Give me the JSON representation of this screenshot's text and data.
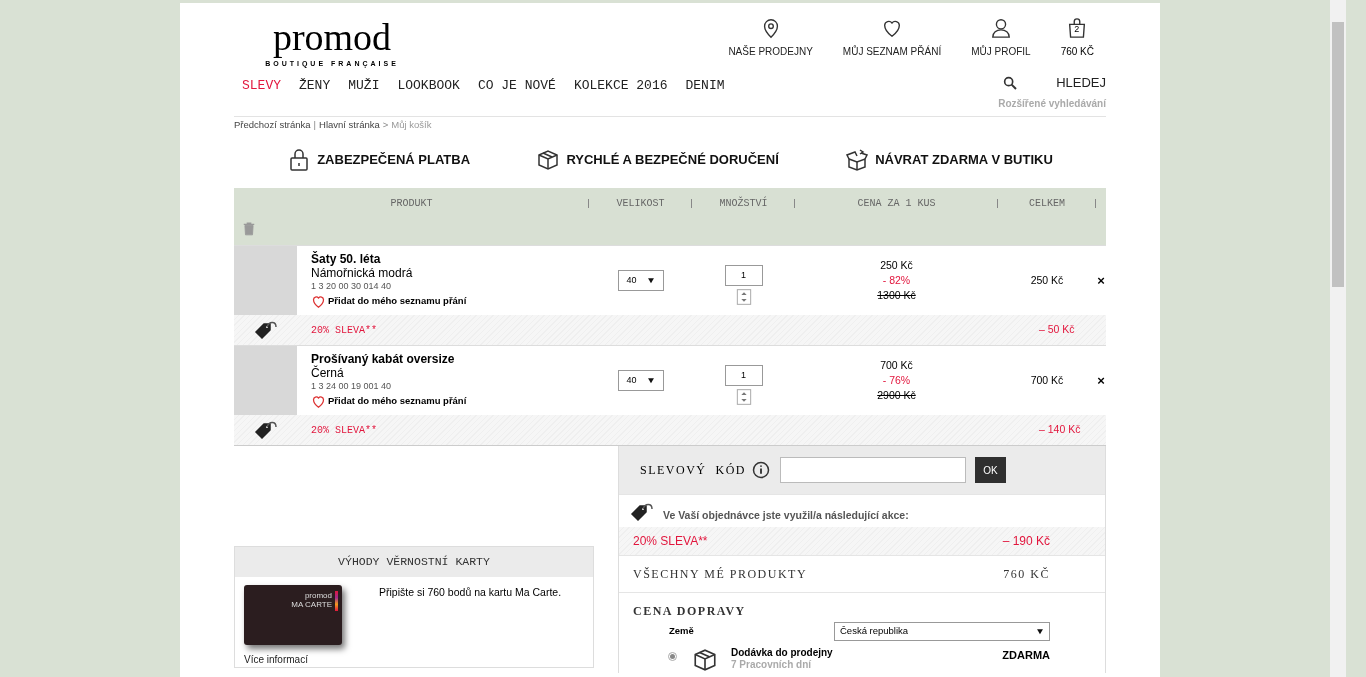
{
  "header": {
    "logo": "promod",
    "tagline": "BOUTIQUE FRANÇAISE",
    "top_links": [
      {
        "kind": "pin",
        "label": "NAŠE PRODEJNY"
      },
      {
        "kind": "heart",
        "label": "MŮJ SEZNAM PŘÁNÍ"
      },
      {
        "kind": "person",
        "label": "MŮJ PROFIL"
      }
    ],
    "cart": {
      "count": "2",
      "total": "760 KČ"
    }
  },
  "nav": [
    {
      "label": "SLEVY",
      "selected": true
    },
    {
      "label": "ŽENY",
      "selected": false
    },
    {
      "label": "MUŽI",
      "selected": false
    },
    {
      "label": "LOOKBOOK",
      "selected": false
    },
    {
      "label": "CO JE NOVÉ",
      "selected": false
    },
    {
      "label": "KOLEKCE 2016",
      "selected": false
    },
    {
      "label": "DENIM",
      "selected": false
    }
  ],
  "search": {
    "label": "HLEDEJ",
    "advanced": "Rozšířené vyhledávání"
  },
  "breadcrumb": [
    {
      "label": "Předchozí stránka",
      "current": false
    },
    {
      "separator": "|",
      "label": "Hlavní stránka",
      "current": false
    },
    {
      "separator": ">",
      "label": "Můj košík",
      "current": true
    }
  ],
  "benefits": [
    {
      "kind": "lock",
      "label": "ZABEZPEČENÁ PLATBA"
    },
    {
      "kind": "box",
      "label": "RYCHLÉ A BEZPEČNÉ DORUČENÍ"
    },
    {
      "kind": "return",
      "label": "NÁVRAT ZDARMA V BUTIKU"
    }
  ],
  "table": {
    "columns": [
      "PRODUKT",
      "VELIKOST",
      "MNOŽSTVÍ",
      "CENA ZA 1 KUS",
      "CELKEM"
    ],
    "rows": [
      {
        "name": "Šaty 50. léta",
        "colour_name": "Námořnická modrá",
        "ref": "1 3 20 00 30 014 40",
        "wishlist": "Přidat do mého seznamu přání",
        "size": "40",
        "quantity": "1",
        "unit_price": "250 Kč",
        "discount": "- 82%",
        "original_price": "1300 Kč",
        "total": "250 Kč",
        "remove": "×",
        "promo": {
          "label": "20% SLEVA**",
          "amount": "–  50 Kč"
        }
      },
      {
        "name": "Prošívaný kabát oversize",
        "colour_name": "Černá",
        "ref": "1 3 24 00 19 001 40",
        "wishlist": "Přidat do mého seznamu přání",
        "size": "40",
        "quantity": "1",
        "unit_price": "700 Kč",
        "discount": "- 76%",
        "original_price": "2900 Kč",
        "total": "700 Kč",
        "remove": "×",
        "promo": {
          "label": "20% SLEVA**",
          "amount": "–  140 Kč"
        }
      }
    ]
  },
  "coupon": {
    "label": "SLEVOVÝ  KÓD",
    "button": "OK"
  },
  "promotions": {
    "title": "Ve Vaší objednávce jste využil/a následující akce:",
    "items": [
      {
        "label": "20% SLEVA**",
        "amount": "–  190 Kč"
      }
    ]
  },
  "subtotal": {
    "label": "VŠECHNY MÉ PRODUKTY",
    "value": "760 KČ"
  },
  "shipping": {
    "title": "CENA DOPRAVY",
    "country_label": "Země",
    "country": "Česká republika",
    "options": [
      {
        "name": "Dodávka do prodejny",
        "time": "7 Pracovních dní",
        "price": "ZDARMA",
        "selected": true
      }
    ]
  },
  "loyalty": {
    "title": "VÝHODY VĚRNOSTNÍ KARTY",
    "card_brand": "promod",
    "card_sub": "MA CARTE",
    "text": "Připište si 760 bodů na kartu Ma Carte.",
    "link": "Více informací"
  }
}
